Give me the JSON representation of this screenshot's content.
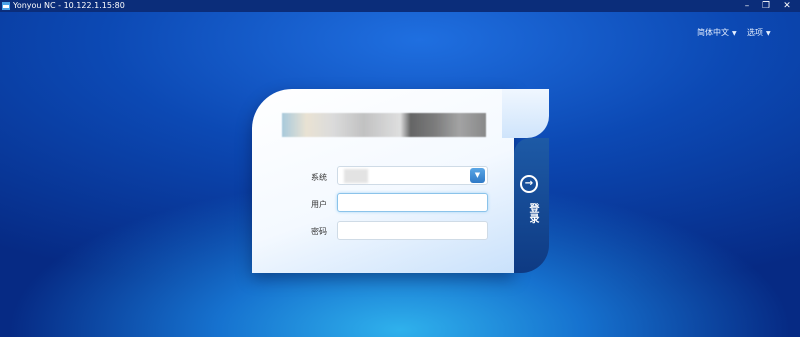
{
  "window": {
    "title": "Yonyou NC - 10.122.1.15:80"
  },
  "menu": {
    "language": "简体中文",
    "options": "选项"
  },
  "form": {
    "system_label": "系统",
    "user_label": "用户",
    "password_label": "密码",
    "system_value": "",
    "user_value": "",
    "password_value": ""
  },
  "login": {
    "label": "登录",
    "icon": "login-arrow-icon"
  },
  "colors": {
    "accent": "#1d5aa6",
    "background": "#0c49b4"
  }
}
